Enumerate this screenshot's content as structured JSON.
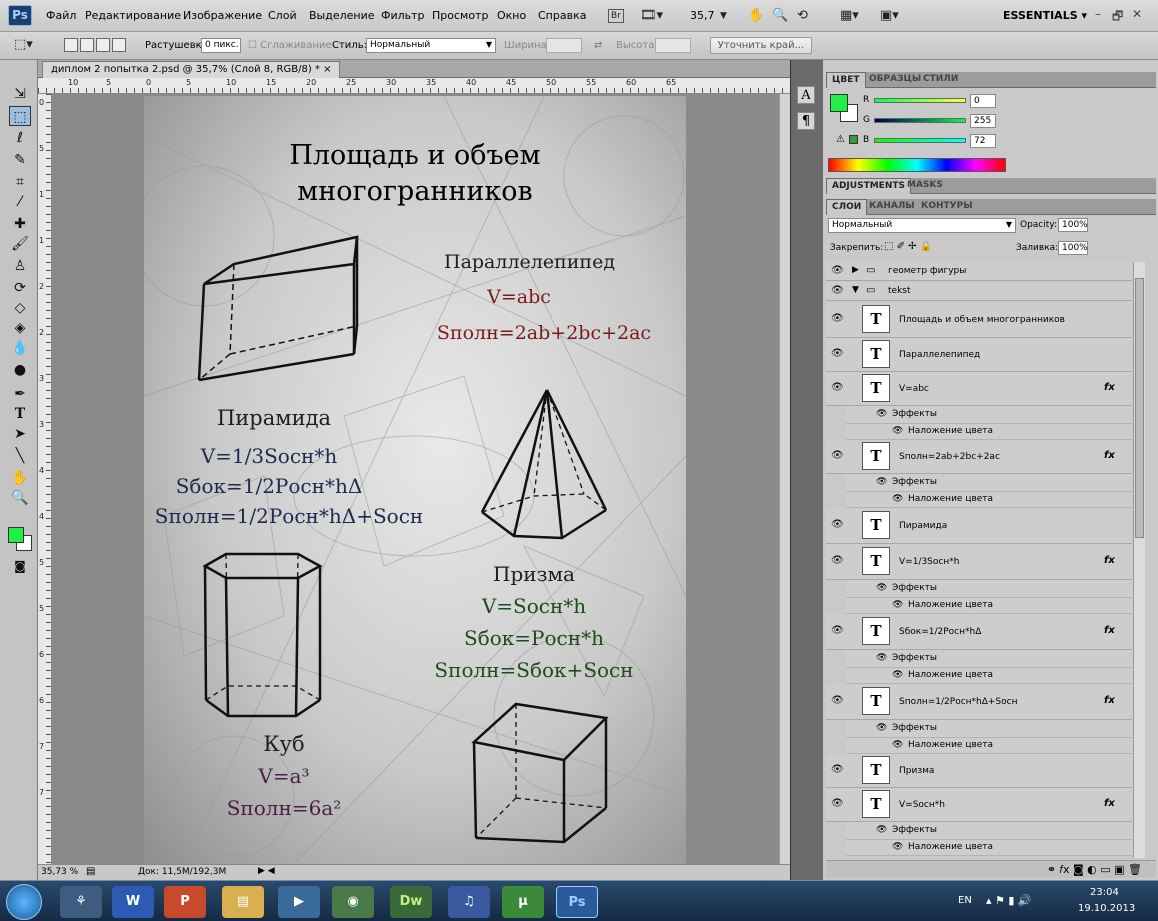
{
  "app": {
    "logo": "Ps",
    "menu": [
      "Файл",
      "Редактирование",
      "Изображение",
      "Слой",
      "Выделение",
      "Фильтр",
      "Просмотр",
      "Окно",
      "Справка"
    ],
    "zoom": "35,7",
    "workspace": "ESSENTIALS ▾",
    "win_controls": [
      "–",
      "🗗",
      "✕"
    ]
  },
  "options": {
    "feather_label": "Растушевка:",
    "feather_value": "0 пикс.",
    "antialias_label": "Сглаживание",
    "style_label": "Стиль:",
    "style_value": "Нормальный",
    "width_label": "Ширина:",
    "height_label": "Высота:",
    "refine_label": "Уточнить край..."
  },
  "document": {
    "tab_title": "диплом 2 попытка 2.psd @ 35,7% (Слой 8, RGB/8) *",
    "tab_close": "×",
    "status_zoom": "35,73 %",
    "status_doc": "Док: 11,5M/192,3M",
    "ruler_top": [
      "10",
      "5",
      "0",
      "5",
      "10",
      "15",
      "20",
      "25",
      "30",
      "35",
      "40",
      "45",
      "50",
      "55",
      "60",
      "65"
    ],
    "ruler_left": [
      "0",
      "5",
      "1",
      "1",
      "2",
      "2",
      "3",
      "3",
      "4",
      "4",
      "5",
      "5",
      "6",
      "6",
      "7",
      "7"
    ]
  },
  "poster": {
    "title_line1": "Площадь и объем",
    "title_line2": "многогранников",
    "para_title": "Параллелепипед",
    "para_v": "V=abc",
    "para_s": "Sполн=2ab+2bc+2ac",
    "pyr_title": "Пирамида",
    "pyr_v": "V=1/3Sосн*h",
    "pyr_sb": "Sбок=1/2Pосн*hΔ",
    "pyr_sp": "Sполн=1/2Pосн*hΔ+Sосн",
    "prism_title": "Призма",
    "prism_v": "V=Sосн*h",
    "prism_sb": "Sбок=Pосн*h",
    "prism_sp": "Sполн=Sбок+Sосн",
    "cube_title": "Куб",
    "cube_v": "V=a³",
    "cube_s": "Sполн=6a²",
    "colors": {
      "title": "#1e1e1e",
      "para_formula": "#7a1a1a",
      "pyr_formula": "#1e2a4e",
      "prism_formula": "#1d4d1d",
      "cube_formula": "#4a1e4a"
    }
  },
  "color_panel": {
    "tabs": [
      "ЦВЕТ",
      "ОБРАЗЦЫ",
      "СТИЛИ"
    ],
    "r_label": "R",
    "g_label": "G",
    "b_label": "B",
    "r": "0",
    "g": "255",
    "b": "72",
    "fg": "#1ef046"
  },
  "adjust_tabs": [
    "ADJUSTMENTS",
    "MASKS"
  ],
  "layers_panel": {
    "tabs": [
      "СЛОИ",
      "КАНАЛЫ",
      "КОНТУРЫ"
    ],
    "blend": "Нормальный",
    "opacity_label": "Opacity:",
    "opacity": "100%",
    "lock_label": "Закрепить:",
    "fill_label": "Заливка:",
    "fill": "100%",
    "groups": [
      "геометр фигуры",
      "tekst"
    ],
    "effects_label": "Эффекты",
    "overlay_label": "Наложение цвета",
    "fx": "fx",
    "layers": [
      "Площадь и объем многогранников",
      "Параллелепипед",
      "V=abc",
      "Sполн=2ab+2bc+2ac",
      "Пирамида",
      "V=1/3Sосн*h",
      "Sбок=1/2Pосн*hΔ",
      "Sполн=1/2Pосн*hΔ+Sосн",
      "Призма",
      "V=Sосн*h"
    ]
  },
  "taskbar": {
    "lang": "EN",
    "time": "23:04",
    "date": "19.10.2013",
    "apps": [
      "W",
      "P",
      "Dw",
      "Ps"
    ]
  }
}
